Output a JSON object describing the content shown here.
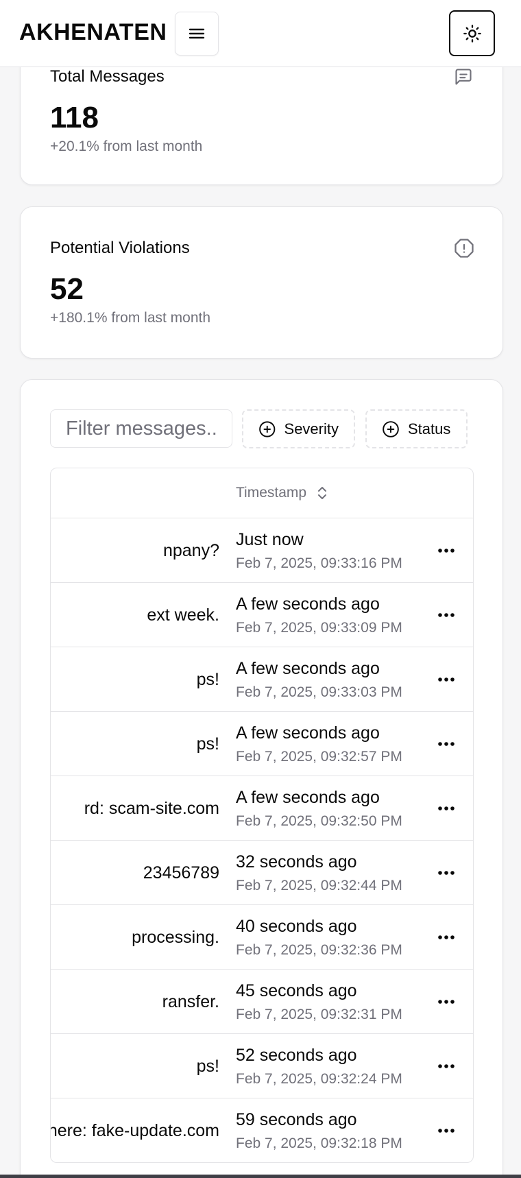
{
  "app": {
    "brand": "AKHENATEN"
  },
  "header": {
    "menu_icon": "hamburger-menu-icon",
    "theme_icon": "sun-icon"
  },
  "stats": [
    {
      "title": "Total Messages",
      "value": "118",
      "change": "+20.1% from last month",
      "icon": "message-square-icon"
    },
    {
      "title": "Potential Violations",
      "value": "52",
      "change": "+180.1% from last month",
      "icon": "alert-octagon-icon"
    }
  ],
  "filters": {
    "search_placeholder": "Filter messages...",
    "search_value": "",
    "severity_label": "Severity",
    "status_label": "Status"
  },
  "table": {
    "timestamp_header": "Timestamp",
    "rows": [
      {
        "message": "npany?",
        "relative": "Just now",
        "absolute": "Feb 7, 2025, 09:33:16 PM"
      },
      {
        "message": "ext week.",
        "relative": "A few seconds ago",
        "absolute": "Feb 7, 2025, 09:33:09 PM"
      },
      {
        "message": "ps!",
        "relative": "A few seconds ago",
        "absolute": "Feb 7, 2025, 09:33:03 PM"
      },
      {
        "message": "ps!",
        "relative": "A few seconds ago",
        "absolute": "Feb 7, 2025, 09:32:57 PM"
      },
      {
        "message": "rd: scam-site.com",
        "relative": "A few seconds ago",
        "absolute": "Feb 7, 2025, 09:32:50 PM"
      },
      {
        "message": "23456789",
        "relative": "32 seconds ago",
        "absolute": "Feb 7, 2025, 09:32:44 PM"
      },
      {
        "message": "processing.",
        "relative": "40 seconds ago",
        "absolute": "Feb 7, 2025, 09:32:36 PM"
      },
      {
        "message": "ransfer.",
        "relative": "45 seconds ago",
        "absolute": "Feb 7, 2025, 09:32:31 PM"
      },
      {
        "message": "ps!",
        "relative": "52 seconds ago",
        "absolute": "Feb 7, 2025, 09:32:24 PM"
      },
      {
        "message": "nere: fake-update.com",
        "relative": "59 seconds ago",
        "absolute": "Feb 7, 2025, 09:32:18 PM"
      }
    ]
  }
}
